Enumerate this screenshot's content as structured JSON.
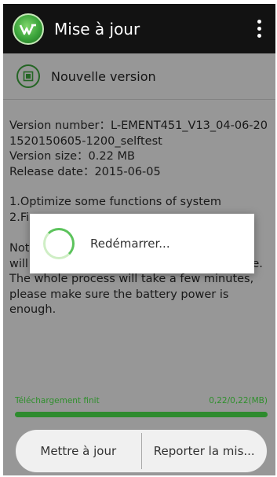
{
  "appbar": {
    "title": "Mise à jour",
    "logo_icon": "app-logo-icon",
    "menu_icon": "overflow-menu-icon"
  },
  "section": {
    "icon": "update-package-icon",
    "title": "Nouvelle version"
  },
  "info": {
    "version_number": "Version number：L-EMENT451_V13_04-06-201520150605-1200_selftest",
    "version_size": "Version size：0.22 MB",
    "release_date": "Release date：2015-06-05"
  },
  "notes": {
    "line1": "1.Optimize some functions of system",
    "line2": "2.Fi"
  },
  "notice": {
    "text": "Not                                                          ce will                                                          ode. The whole process will take a few minutes, please make sure the battery power is enough."
  },
  "progress": {
    "status": "Téléchargement finit",
    "amount": "0,22/0,22(MB)",
    "fraction": 1.0,
    "color": "#2e8b2e"
  },
  "buttons": {
    "update": "Mettre à jour",
    "postpone": "Reporter la mis..."
  },
  "dialog": {
    "message": "Redémarrer...",
    "spinner_icon": "loading-spinner-icon"
  },
  "colors": {
    "accent": "#3aa33a",
    "appbar": "#121212"
  }
}
